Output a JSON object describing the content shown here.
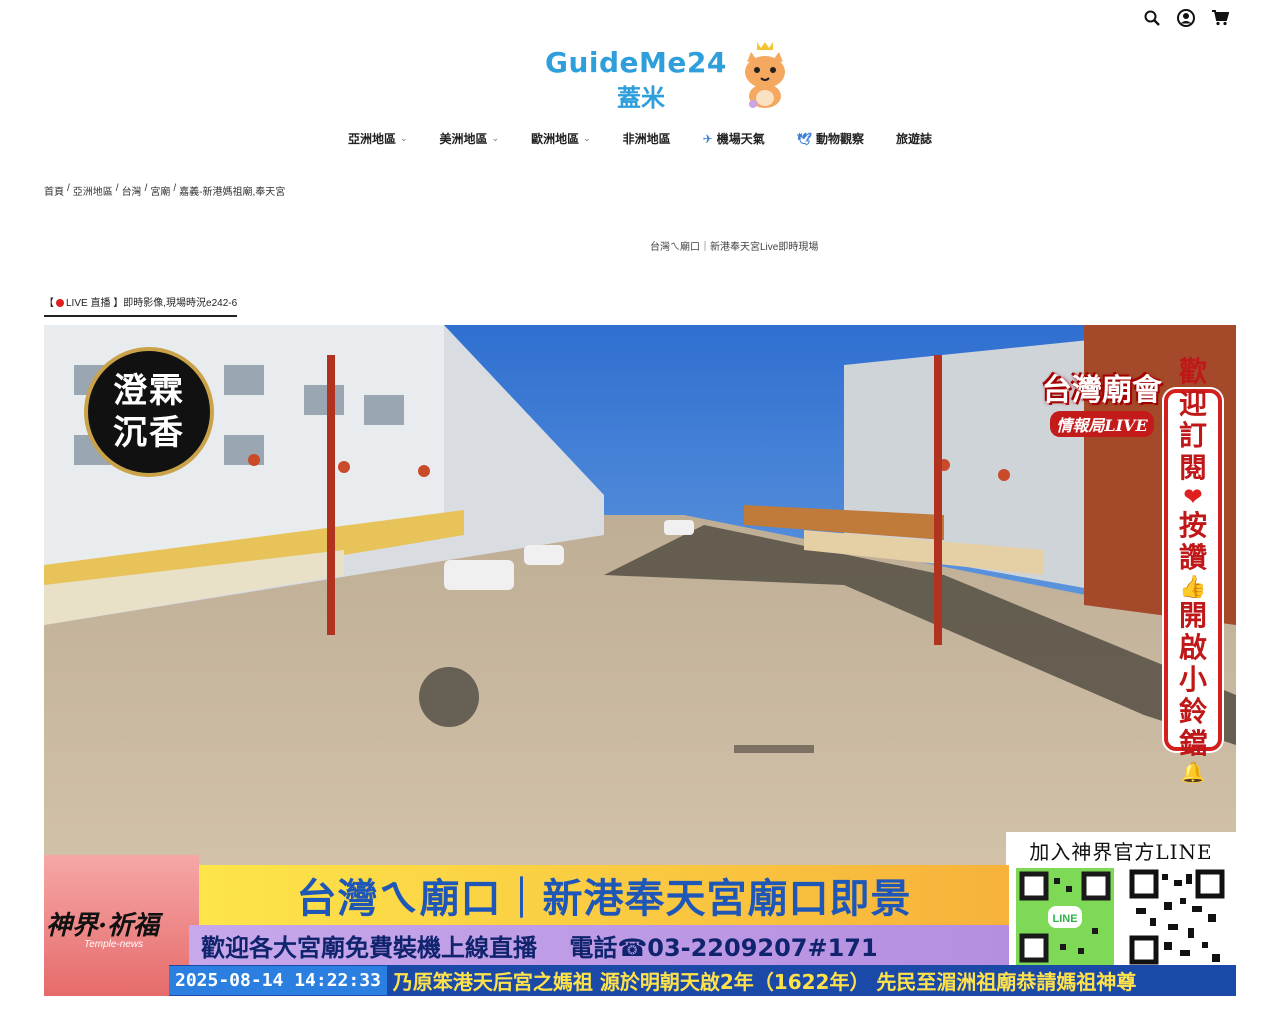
{
  "header": {
    "icons": [
      "search-icon",
      "user-icon",
      "cart-icon"
    ],
    "logo_text": "GuideMe24",
    "logo_sub": "蓋米"
  },
  "nav": {
    "items": [
      {
        "label": "亞洲地區",
        "has_dropdown": true
      },
      {
        "label": "美洲地區",
        "has_dropdown": true
      },
      {
        "label": "歐洲地區",
        "has_dropdown": true
      },
      {
        "label": "非洲地區",
        "has_dropdown": false
      },
      {
        "label": "機場天氣",
        "icon": "airplane-icon",
        "has_dropdown": false
      },
      {
        "label": "動物觀察",
        "icon": "bird-icon",
        "has_dropdown": false
      },
      {
        "label": "旅遊誌",
        "has_dropdown": false
      }
    ]
  },
  "breadcrumb": [
    "首頁",
    "亞洲地區",
    "台灣",
    "宮廟",
    "嘉義-新港媽祖廟,奉天宮"
  ],
  "page": {
    "subtitle": "台灣ㄟ廟口｜新港奉天宮Live即時現場",
    "live_tab_prefix": "【",
    "live_tab_label": "LIVE 直播 】即時影像,現場時況e242-6"
  },
  "video": {
    "badge_left": [
      "澄霖",
      "沉香"
    ],
    "brand_right_title": "台灣廟會",
    "brand_right_sub": "情報局LIVE",
    "subscribe": [
      "歡",
      "迎",
      "訂",
      "閱",
      "按",
      "讚",
      "開",
      "啟",
      "小",
      "鈴",
      "鐺"
    ],
    "line_title": "加入神界官方LINE",
    "banner_logo": "神界·祈福",
    "banner_logo_sub": "Temple-news",
    "banner_main": "台灣ㄟ廟口｜新港奉天宮廟口即景",
    "banner_sub": "歡迎各大宮廟免費裝機上線直播　 電話☎03-2209207#171",
    "timestamp": "2025-08-14 14:22:33",
    "ticker": "乃原笨港天后宮之媽祖 源於明朝天啟2年（1622年） 先民至湄洲祖廟恭請媽祖神尊"
  },
  "colors": {
    "brand_blue": "#2f9fdc",
    "banner_yellow": "#fde54a",
    "banner_purple": "#b58ee0",
    "ticker_blue": "#1a49a8",
    "accent_red": "#d41f1f"
  }
}
